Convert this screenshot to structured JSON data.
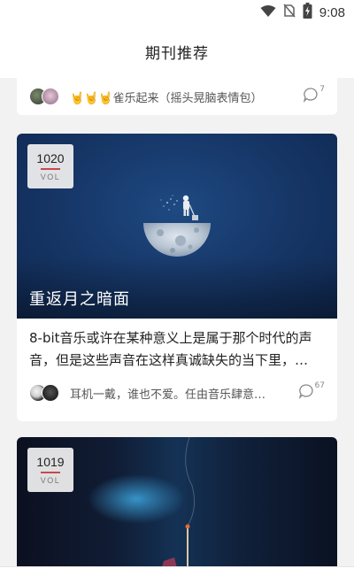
{
  "status_bar": {
    "time": "9:08",
    "icons": [
      "wifi-icon",
      "no-sim-icon",
      "battery-charging-icon"
    ]
  },
  "header": {
    "title": "期刊推荐"
  },
  "cards": [
    {
      "id": "partial",
      "meta_text": "🤘🤘🤘雀乐起来（摇头晃脑表情包）",
      "comment_count": "7"
    },
    {
      "id": "vol1020",
      "vol_number": "1020",
      "vol_label": "VOL",
      "cover_title": "重返月之暗面",
      "excerpt": "8-bit音乐或许在某种意义上是属于那个时代的声音，但是这些声音在这样真诚缺失的当下里，…",
      "meta_text": "耳机一戴，谁也不爱。任由音乐肆意…",
      "comment_count": "67"
    },
    {
      "id": "vol1019",
      "vol_number": "1019",
      "vol_label": "VOL"
    }
  ],
  "colors": {
    "accent": "#c74a4a",
    "background": "#f2f2f2",
    "card": "#ffffff"
  }
}
